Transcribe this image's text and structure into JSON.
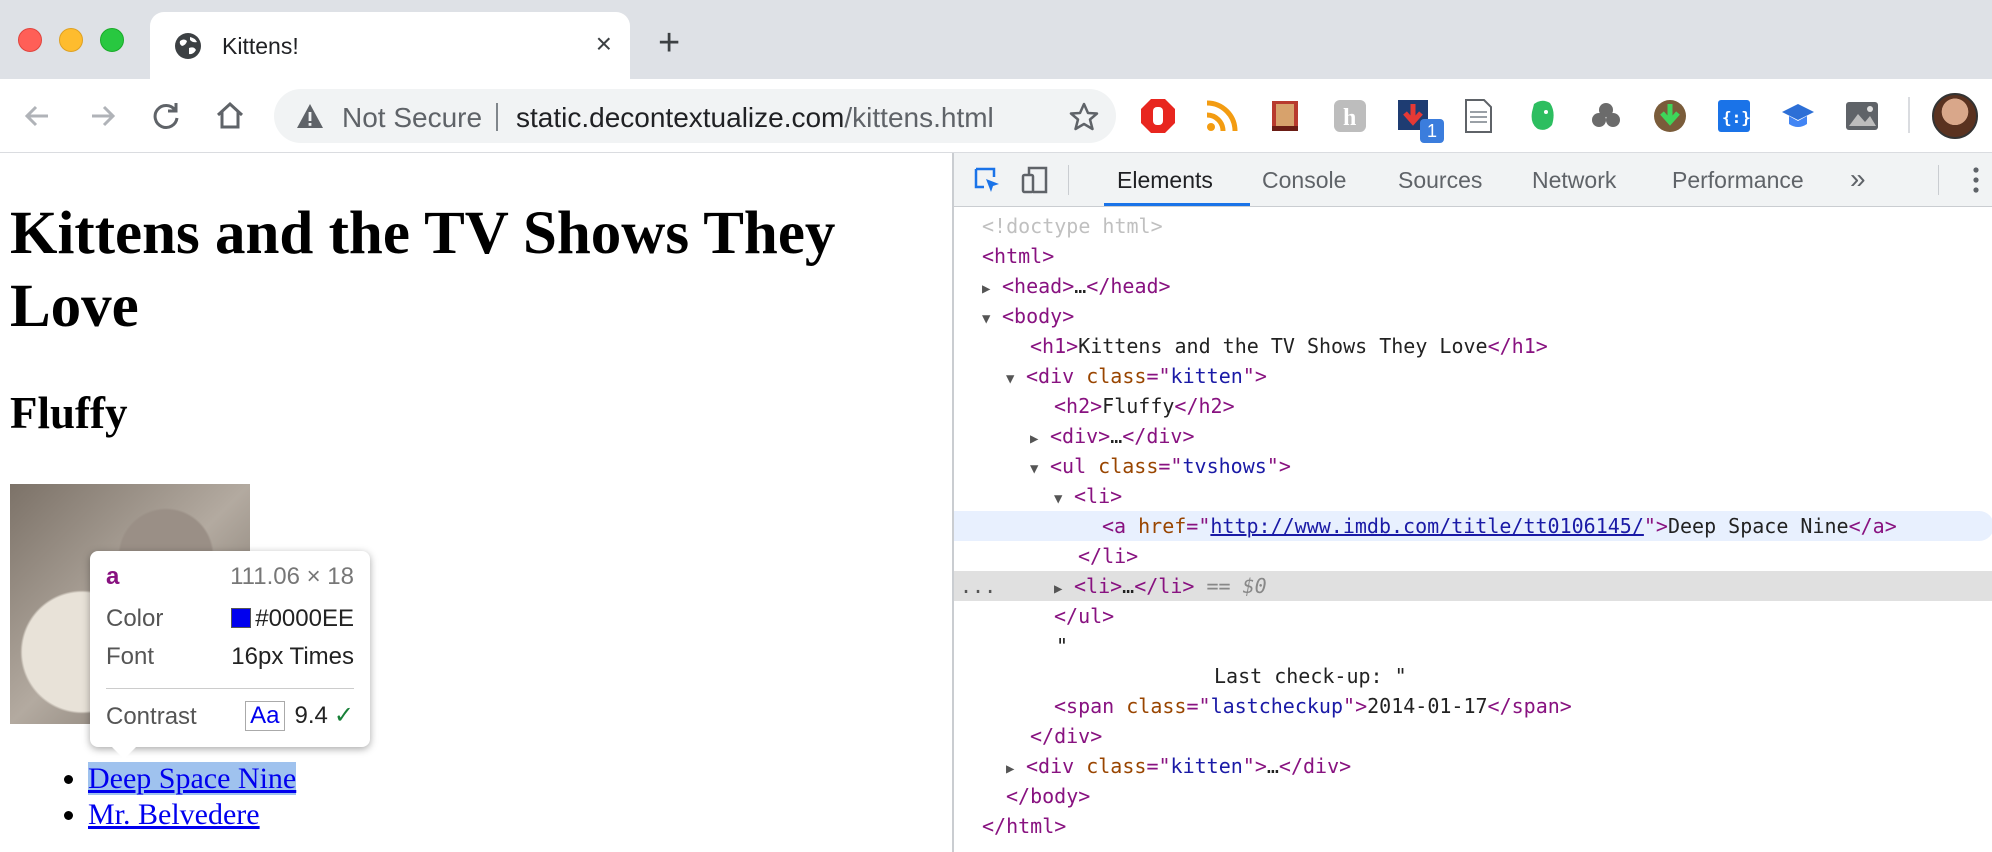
{
  "browser": {
    "tab_title": "Kittens!",
    "tab_close": "×",
    "new_tab": "+",
    "omnibox": {
      "security_label": "Not Secure",
      "host": "static.decontextualize.com",
      "path": "/kittens.html"
    },
    "extension_badge": "1"
  },
  "page": {
    "h1": "Kittens and the TV Shows They Love",
    "h2": "Fluffy",
    "links": [
      "Deep Space Nine",
      "Mr. Belvedere"
    ],
    "tooltip": {
      "tag": "a",
      "size": "111.06 × 18",
      "color_label": "Color",
      "color_value": "#0000EE",
      "font_label": "Font",
      "font_value": "16px Times",
      "contrast_label": "Contrast",
      "contrast_sample": "Aa",
      "contrast_value": "9.4",
      "contrast_check": "✓"
    }
  },
  "devtools": {
    "tabs": [
      "Elements",
      "Console",
      "Sources",
      "Network",
      "Performance"
    ],
    "active_tab": "Elements",
    "more": "»",
    "tree": {
      "doctype": "<!doctype html>",
      "h1_text": "Kittens and the TV Shows They Love",
      "div_class": "kitten",
      "h2_text": "Fluffy",
      "ul_class": "tvshows",
      "href": "http://www.imdb.com/title/tt0106145/",
      "a_text": "Deep Space Nine",
      "selected_marker": "== $0",
      "text_node_open": "\"",
      "text_node_content": "Last check-up: \"",
      "span_class": "lastcheckup",
      "span_text": "2014-01-17",
      "ellipsis": "…",
      "row_dots": "..."
    }
  },
  "colors": {
    "link": "#0000EE",
    "devtools_accent": "#1a73e8",
    "tag": "#881280",
    "attr": "#994500",
    "attr_value": "#1a1aa6"
  }
}
